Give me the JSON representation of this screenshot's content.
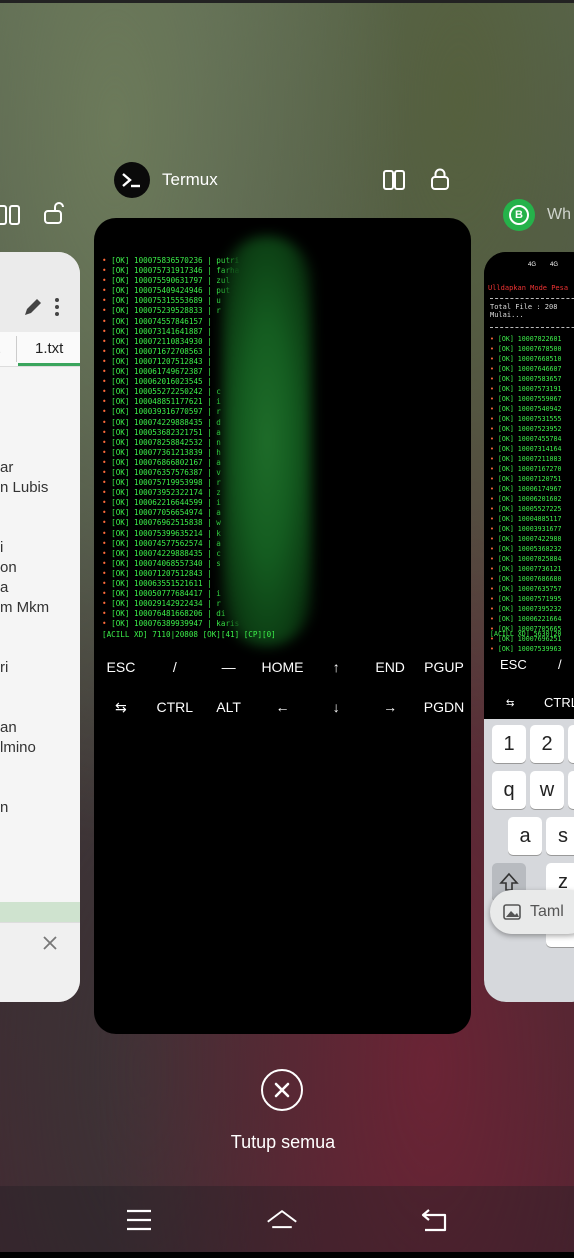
{
  "recents": {
    "current_app": {
      "name": "Termux",
      "icon": "terminal-prompt-icon",
      "header_icons": [
        "split-screen-icon",
        "lock-icon"
      ]
    },
    "left_app": {
      "header_icons": [
        "split-screen-icon",
        "unlock-icon"
      ],
      "tab_partial": "t",
      "tab_active": "1.txt",
      "text_lines": [
        "ar",
        "n Lubis",
        "",
        "",
        "i",
        "on",
        "a",
        "m Mkm",
        "",
        "",
        "ri",
        "",
        "",
        "an",
        "lmino",
        "",
        "",
        "n"
      ]
    },
    "right_app": {
      "name_partial": "Wh",
      "title_line": "Ulldapkan Mode Pesa",
      "box_line1": "Total File : 208",
      "box_line2": "Mulai...",
      "key_esc": "ESC",
      "key_slash": "/",
      "key_ctrl": "CTRL",
      "status_line": "[ACILL XD] 5630|20",
      "kbd_row1": [
        "1",
        "2",
        "3"
      ],
      "kbd_row2": [
        "q",
        "w",
        "e"
      ],
      "kbd_row3": [
        "a",
        "s"
      ],
      "kbd_row4": [
        "z"
      ],
      "tooltip": "Taml"
    }
  },
  "terminal": {
    "lines": [
      "[OK] 100075836570236 | putri",
      "[OK] 100075731917346 | farha",
      "[OK] 100075590631797 | zul",
      "[OK] 100075409424946 | put",
      "[OK] 100075315553689 | u",
      "[OK] 100075239528833 | r",
      "[OK] 100074557846157 |",
      "[OK] 100073141641887 |",
      "[OK] 100072110834930 |",
      "[OK] 100071672708563 |",
      "[OK] 100071207512843 |",
      "[OK] 100061749672387 |",
      "[OK] 100062016023545 |",
      "[OK] 100055272250242 | c",
      "[OK] 100048851177621 | i",
      "[OK] 100039316770597 | r",
      "[OK] 100074229888435 | d",
      "[OK] 100053682321751 | a",
      "[OK] 100078258842532 | n",
      "[OK] 100077361213839 | h",
      "[OK] 100076866802167 | a",
      "[OK] 100076357576387 | v",
      "[OK] 100075719953998 | r",
      "[OK] 100073952322174 | z",
      "[OK] 100062216644599 | i",
      "[OK] 100077056654974 | a",
      "[OK] 100076962515838 | w",
      "[OK] 100075399635214 | k",
      "[OK] 100074577562574 | a",
      "[OK] 100074229888435 | c",
      "[OK] 100074068557340 | s",
      "[OK] 100071207512843 |",
      "[OK] 100063551521611 |",
      "[OK] 100050777684417 | i",
      "[OK] 100029142922434 | r",
      "[OK] 100076481668206 | di",
      "[OK] 100076389939947 | karis"
    ],
    "status": "[ACILL XD] 7110|20808 [OK][41] [CP][0]",
    "extra_keys_row1": [
      "ESC",
      "/",
      "—",
      "HOME",
      "↑",
      "END",
      "PGUP"
    ],
    "extra_keys_row2": [
      "⇆",
      "CTRL",
      "ALT",
      "←",
      "↓",
      "→",
      "PGDN"
    ]
  },
  "right_terminal_lines": [
    "[OK] 10007822601",
    "[OK] 10007678500",
    "[OK] 10007668510",
    "[OK] 10007646607",
    "[OK] 10007583657",
    "[OK] 10007573191",
    "[OK] 10007559067",
    "[OK] 10007540942",
    "[OK] 10007531555",
    "[OK] 10007523952",
    "[OK] 10007455784",
    "[OK] 10007314164",
    "[OK] 10007211083",
    "[OK] 10007167270",
    "[OK] 10007120751",
    "[OK] 10006174967",
    "[OK] 10006201602",
    "[OK] 10005527225",
    "[OK] 10004885117",
    "[OK] 10003931677",
    "[OK] 10007422988",
    "[OK] 10005368232",
    "[OK] 10007825884",
    "[OK] 10007736121",
    "[OK] 10007686680",
    "[OK] 10007635757",
    "[OK] 10007571995",
    "[OK] 10007395232",
    "[OK] 10006221664",
    "[OK] 10007705665",
    "[OK] 10007696251",
    "[OK] 10007539963"
  ],
  "close_all": {
    "label": "Tutup semua"
  },
  "navbar": {
    "buttons": [
      "menu-icon",
      "home-icon",
      "back-icon"
    ]
  }
}
